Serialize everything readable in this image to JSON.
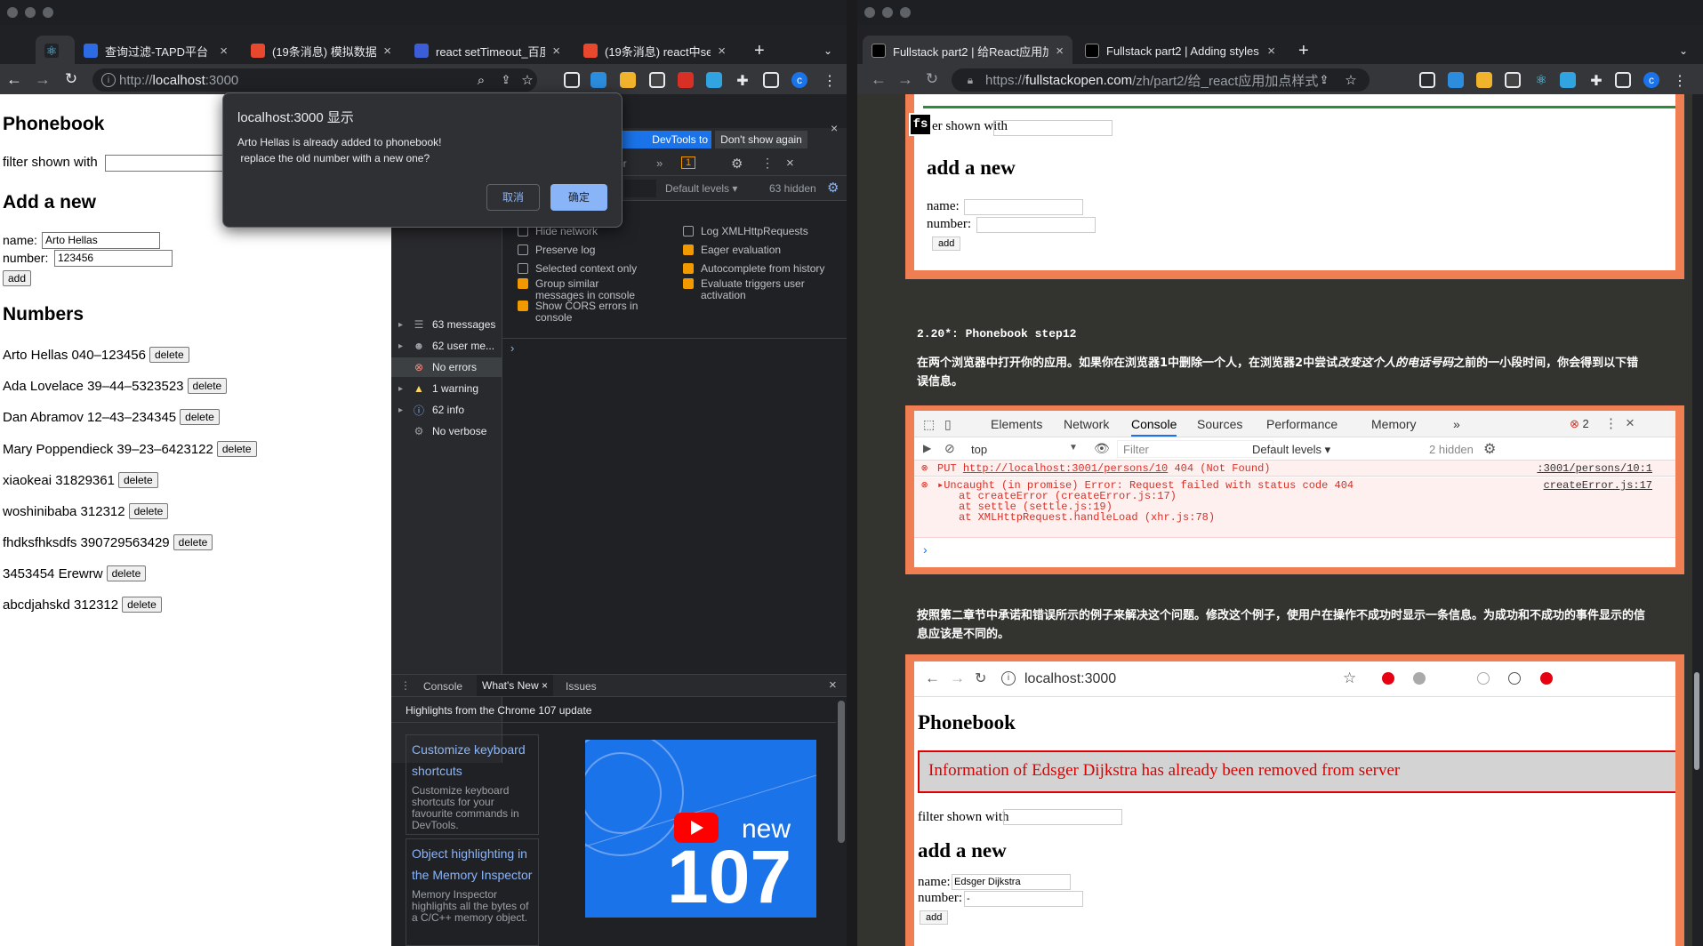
{
  "left_window": {
    "tabs": [
      {
        "label": "",
        "favicon": "react-icon",
        "active": true
      },
      {
        "label": "查询过滤-TAPD平台",
        "favicon": "tapd-icon",
        "close": "×"
      },
      {
        "label": "(19条消息) 模拟数据 js",
        "favicon": "csdn-icon",
        "close": "×"
      },
      {
        "label": "react setTimeout_百度",
        "favicon": "baidu-icon",
        "close": "×"
      },
      {
        "label": "(19条消息) react中set",
        "favicon": "csdn-icon",
        "close": "×"
      }
    ],
    "new_tab": "+",
    "url_prefix": "http://",
    "url_host": "localhost",
    "url_rest": ":3000",
    "profile": "c"
  },
  "phonebook": {
    "title": "Phonebook",
    "filter_label": "filter shown with",
    "filter_value": "",
    "add_heading": "Add a new",
    "name_label": "name:",
    "name_value": "Arto Hellas",
    "number_label": "number:",
    "number_value": "123456",
    "add_button": "add",
    "numbers_heading": "Numbers",
    "delete_label": "delete",
    "entries": [
      "Arto Hellas 040–123456",
      "Ada Lovelace 39–44–5323523",
      "Dan Abramov 12–43–234345",
      "Mary Poppendieck 39–23–6423122",
      "xiaokeai 31829361",
      "woshinibaba 312312",
      "fhdksfhksdfs 390729563429",
      "3453454 Erewrw",
      "abcdjahskd 312312"
    ]
  },
  "dialog": {
    "title": "localhost:3000 显示",
    "message_line1": "Arto Hellas is already added to phonebook!",
    "message_line2": " replace the old number with a new one?",
    "cancel": "取消",
    "ok": "确定"
  },
  "devtools": {
    "banner_switch": "DevTools to Chinese",
    "banner_dismiss": "Don't show again",
    "filter_placeholder": "er",
    "default_levels": "Default levels ▾",
    "hidden_count": "63 hidden",
    "issues_badge": "1",
    "sidebar": [
      {
        "label": "63 messages",
        "icon": "list-icon"
      },
      {
        "label": "62 user me...",
        "icon": "user-icon"
      },
      {
        "label": "No errors",
        "icon": "error-icon"
      },
      {
        "label": "1 warning",
        "icon": "warning-icon"
      },
      {
        "label": "62 info",
        "icon": "info-icon"
      },
      {
        "label": "No verbose",
        "icon": "gear-icon"
      }
    ],
    "options_left": [
      {
        "label": "Hide network",
        "checked": false
      },
      {
        "label": "Preserve log",
        "checked": false
      },
      {
        "label": "Selected context only",
        "checked": false
      },
      {
        "label": "Group similar messages in console",
        "checked": true
      },
      {
        "label": "Show CORS errors in console",
        "checked": true
      }
    ],
    "options_right": [
      {
        "label": "Log XMLHttpRequests",
        "checked": false
      },
      {
        "label": "Eager evaluation",
        "checked": true
      },
      {
        "label": "Autocomplete from history",
        "checked": true
      },
      {
        "label": "Evaluate triggers user activation",
        "checked": true
      }
    ],
    "prompt": "›",
    "drawer_tabs": [
      "Console",
      "What's New",
      "Issues"
    ],
    "whats_new_header": "Highlights from the Chrome 107 update",
    "cards": [
      {
        "title": "Customize keyboard shortcuts",
        "body": "Customize keyboard shortcuts for your favourite commands in DevTools."
      },
      {
        "title": "Object highlighting in the Memory Inspector",
        "body": "Memory Inspector highlights all the bytes of a C/C++ memory object."
      }
    ],
    "video_new": "new",
    "video_version": "107"
  },
  "right_window": {
    "tabs": [
      {
        "label": "Fullstack part2 | 给React应用加",
        "close": "×"
      },
      {
        "label": "Fullstack part2 | Adding styles",
        "close": "×"
      }
    ],
    "new_tab": "+",
    "url_prefix": "https://",
    "url_host": "fullstackopen.com",
    "url_rest": "/zh/part2/给_react应用加点样式",
    "profile": "c"
  },
  "article": {
    "fs_badge": "fs",
    "top_filter_text": "er shown with",
    "top_add_heading": "add a new",
    "top_name": "name:",
    "top_number": "number:",
    "top_add": "add",
    "section_heading": "2.20*: Phonebook step12",
    "para1_a": "在两个浏览器中打开你的应用。如果你在浏览器1中删除一个人，在浏览器2中尝试",
    "para1_em": "改变这个人的电话号码",
    "para1_b": "之前的一小段时间，你会得到以下错误信息。",
    "console_tabs": [
      "Elements",
      "Network",
      "Console",
      "Sources",
      "Performance",
      "Memory",
      "»"
    ],
    "console_errors": "2",
    "console_context": "top",
    "console_filter": "Filter",
    "console_levels": "Default levels ▾",
    "console_hidden": "2 hidden",
    "put_line": "PUT ",
    "put_url": "http://localhost:3001/persons/10",
    "put_status": " 404 (Not Found)",
    "put_src": ":3001/persons/10:1",
    "err_line": "▸Uncaught (in promise) Error: Request failed with status code 404",
    "err_src": "createError.js:17",
    "stack": [
      "at createError (createError.js:17)",
      "at settle (settle.js:19)",
      "at XMLHttpRequest.handleLoad (xhr.js:78)"
    ],
    "para2": "按照第二章节中承诺和错误所示的例子来解决这个问题。修改这个例子，使用户在操作不成功时显示一条信息。为成功和不成功的事件显示的信息应该是不同的。",
    "shot_url": "localhost:3000",
    "shot_title": "Phonebook",
    "shot_error": "Information of Edsger Dijkstra has already been removed from server",
    "shot_filter": "filter shown with",
    "shot_add_heading": "add a new",
    "shot_name": "name:",
    "shot_name_value": "Edsger Dijkstra",
    "shot_number": "number:",
    "shot_number_value": "-",
    "shot_add": "add",
    "scroll_top": "↑"
  },
  "colors": {
    "accent": "#ef7e53",
    "error": "#d93025",
    "chrome_blue": "#1a73e8",
    "page_bg": "#33342f"
  }
}
